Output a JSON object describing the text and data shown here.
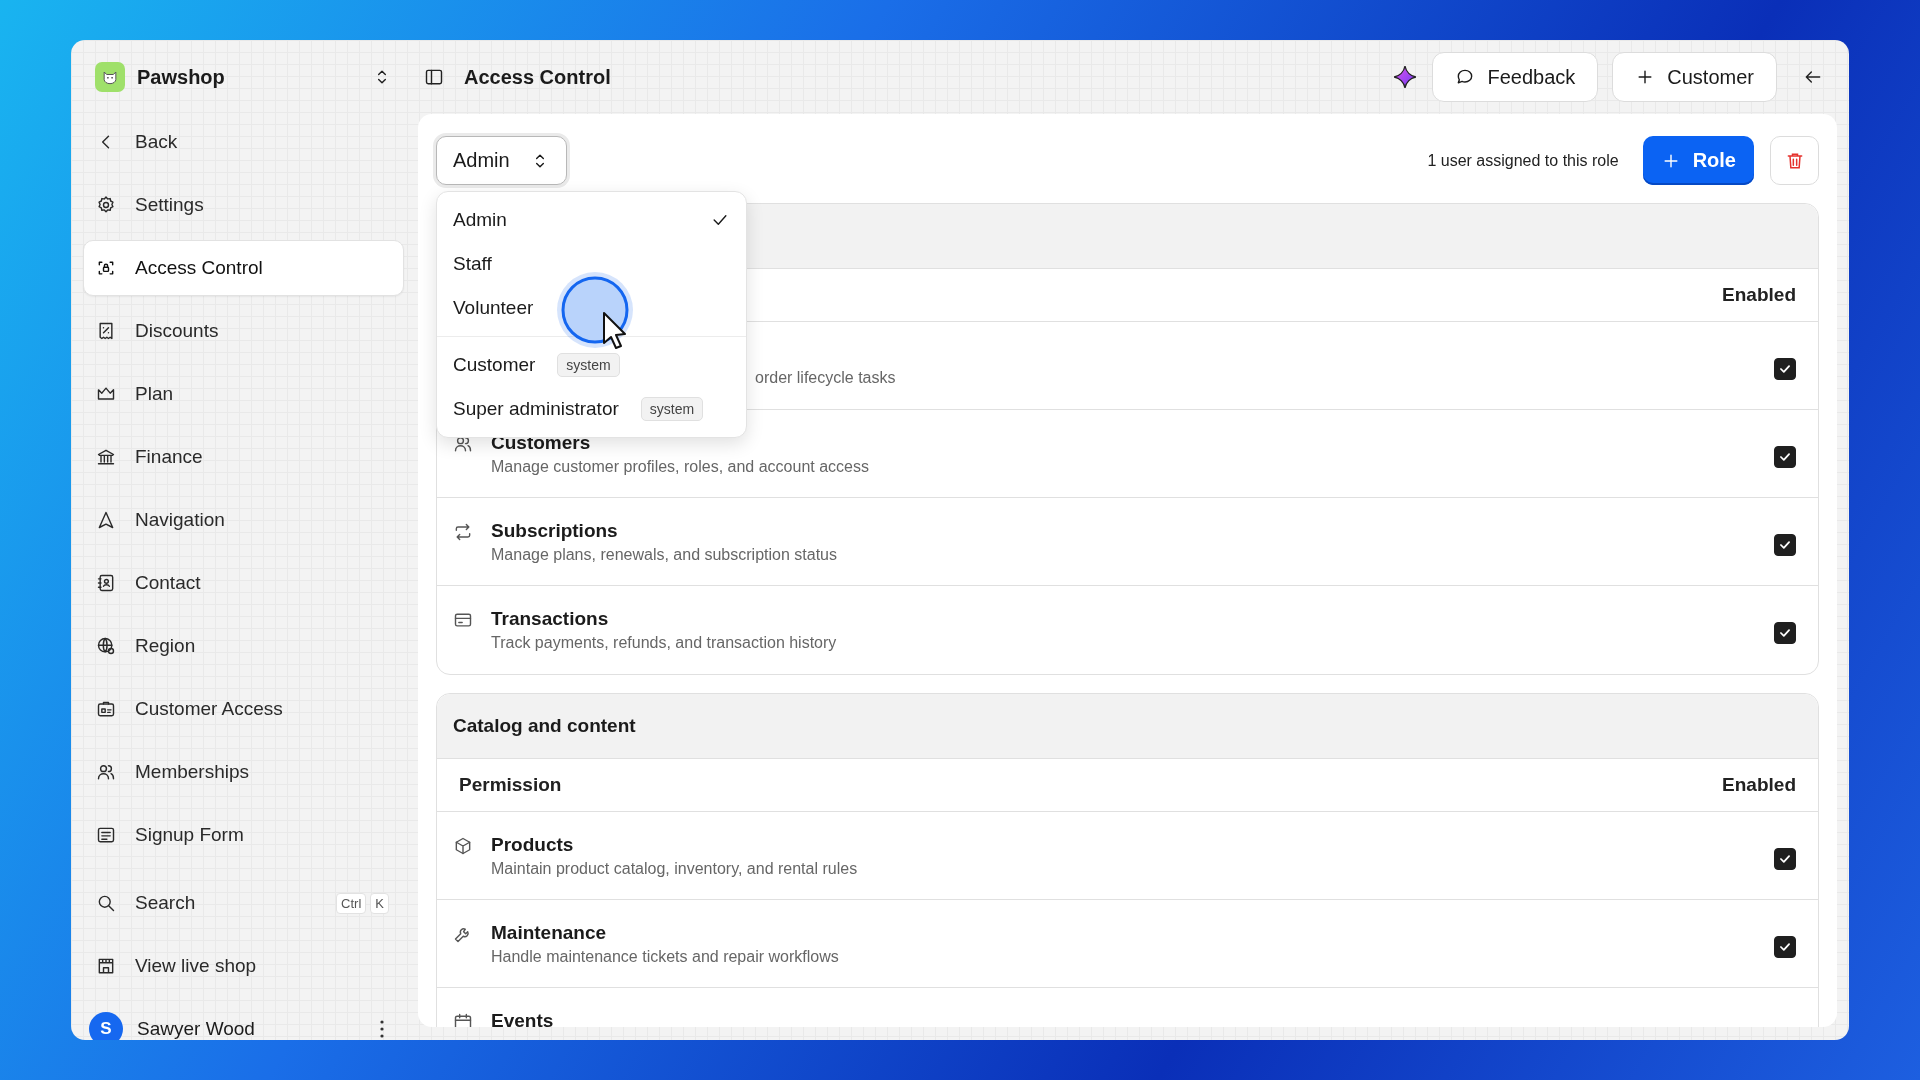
{
  "app": {
    "name": "Pawshop"
  },
  "page_title": "Access Control",
  "header_actions": [
    {
      "label": "Feedback"
    },
    {
      "label": "Customer"
    }
  ],
  "sidebar": {
    "back": "Back",
    "items": [
      {
        "label": "Settings",
        "selected": false
      },
      {
        "label": "Access Control",
        "selected": true
      },
      {
        "label": "Discounts",
        "selected": false
      },
      {
        "label": "Plan",
        "selected": false
      },
      {
        "label": "Finance",
        "selected": false
      },
      {
        "label": "Navigation",
        "selected": false
      },
      {
        "label": "Contact",
        "selected": false
      },
      {
        "label": "Region",
        "selected": false
      },
      {
        "label": "Customer Access",
        "selected": false
      },
      {
        "label": "Memberships",
        "selected": false
      },
      {
        "label": "Signup Form",
        "selected": false
      }
    ],
    "search": {
      "label": "Search",
      "keys": [
        "Ctrl",
        "K"
      ]
    },
    "view_shop": "View live shop",
    "user": {
      "initial": "S",
      "name": "Sawyer Wood"
    }
  },
  "role_select": {
    "value": "Admin",
    "expanded": true,
    "option_groups": [
      [
        {
          "label": "Admin",
          "selected": true
        },
        {
          "label": "Staff",
          "selected": false
        },
        {
          "label": "Volunteer",
          "selected": false
        }
      ],
      [
        {
          "label": "Customer",
          "badge": "system",
          "selected": false
        },
        {
          "label": "Super administrator",
          "badge": "system",
          "selected": false
        }
      ]
    ]
  },
  "assignment_note": "1 user assigned to this role",
  "add_role_button": "Role",
  "sections": [
    {
      "columns": {
        "enabled": "Enabled"
      },
      "rows": [
        {
          "description": "order lifecycle tasks",
          "checked": true
        },
        {
          "title": "Customers",
          "description": "Manage customer profiles, roles, and account access",
          "checked": true
        },
        {
          "title": "Subscriptions",
          "description": "Manage plans, renewals, and subscription status",
          "checked": true
        },
        {
          "title": "Transactions",
          "description": "Track payments, refunds, and transaction history",
          "checked": true
        }
      ]
    },
    {
      "title": "Catalog and content",
      "columns": {
        "permission": "Permission",
        "enabled": "Enabled"
      },
      "rows": [
        {
          "title": "Products",
          "description": "Maintain product catalog, inventory, and rental rules",
          "checked": true
        },
        {
          "title": "Maintenance",
          "description": "Handle maintenance tickets and repair workflows",
          "checked": true
        },
        {
          "title": "Events"
        }
      ]
    }
  ]
}
